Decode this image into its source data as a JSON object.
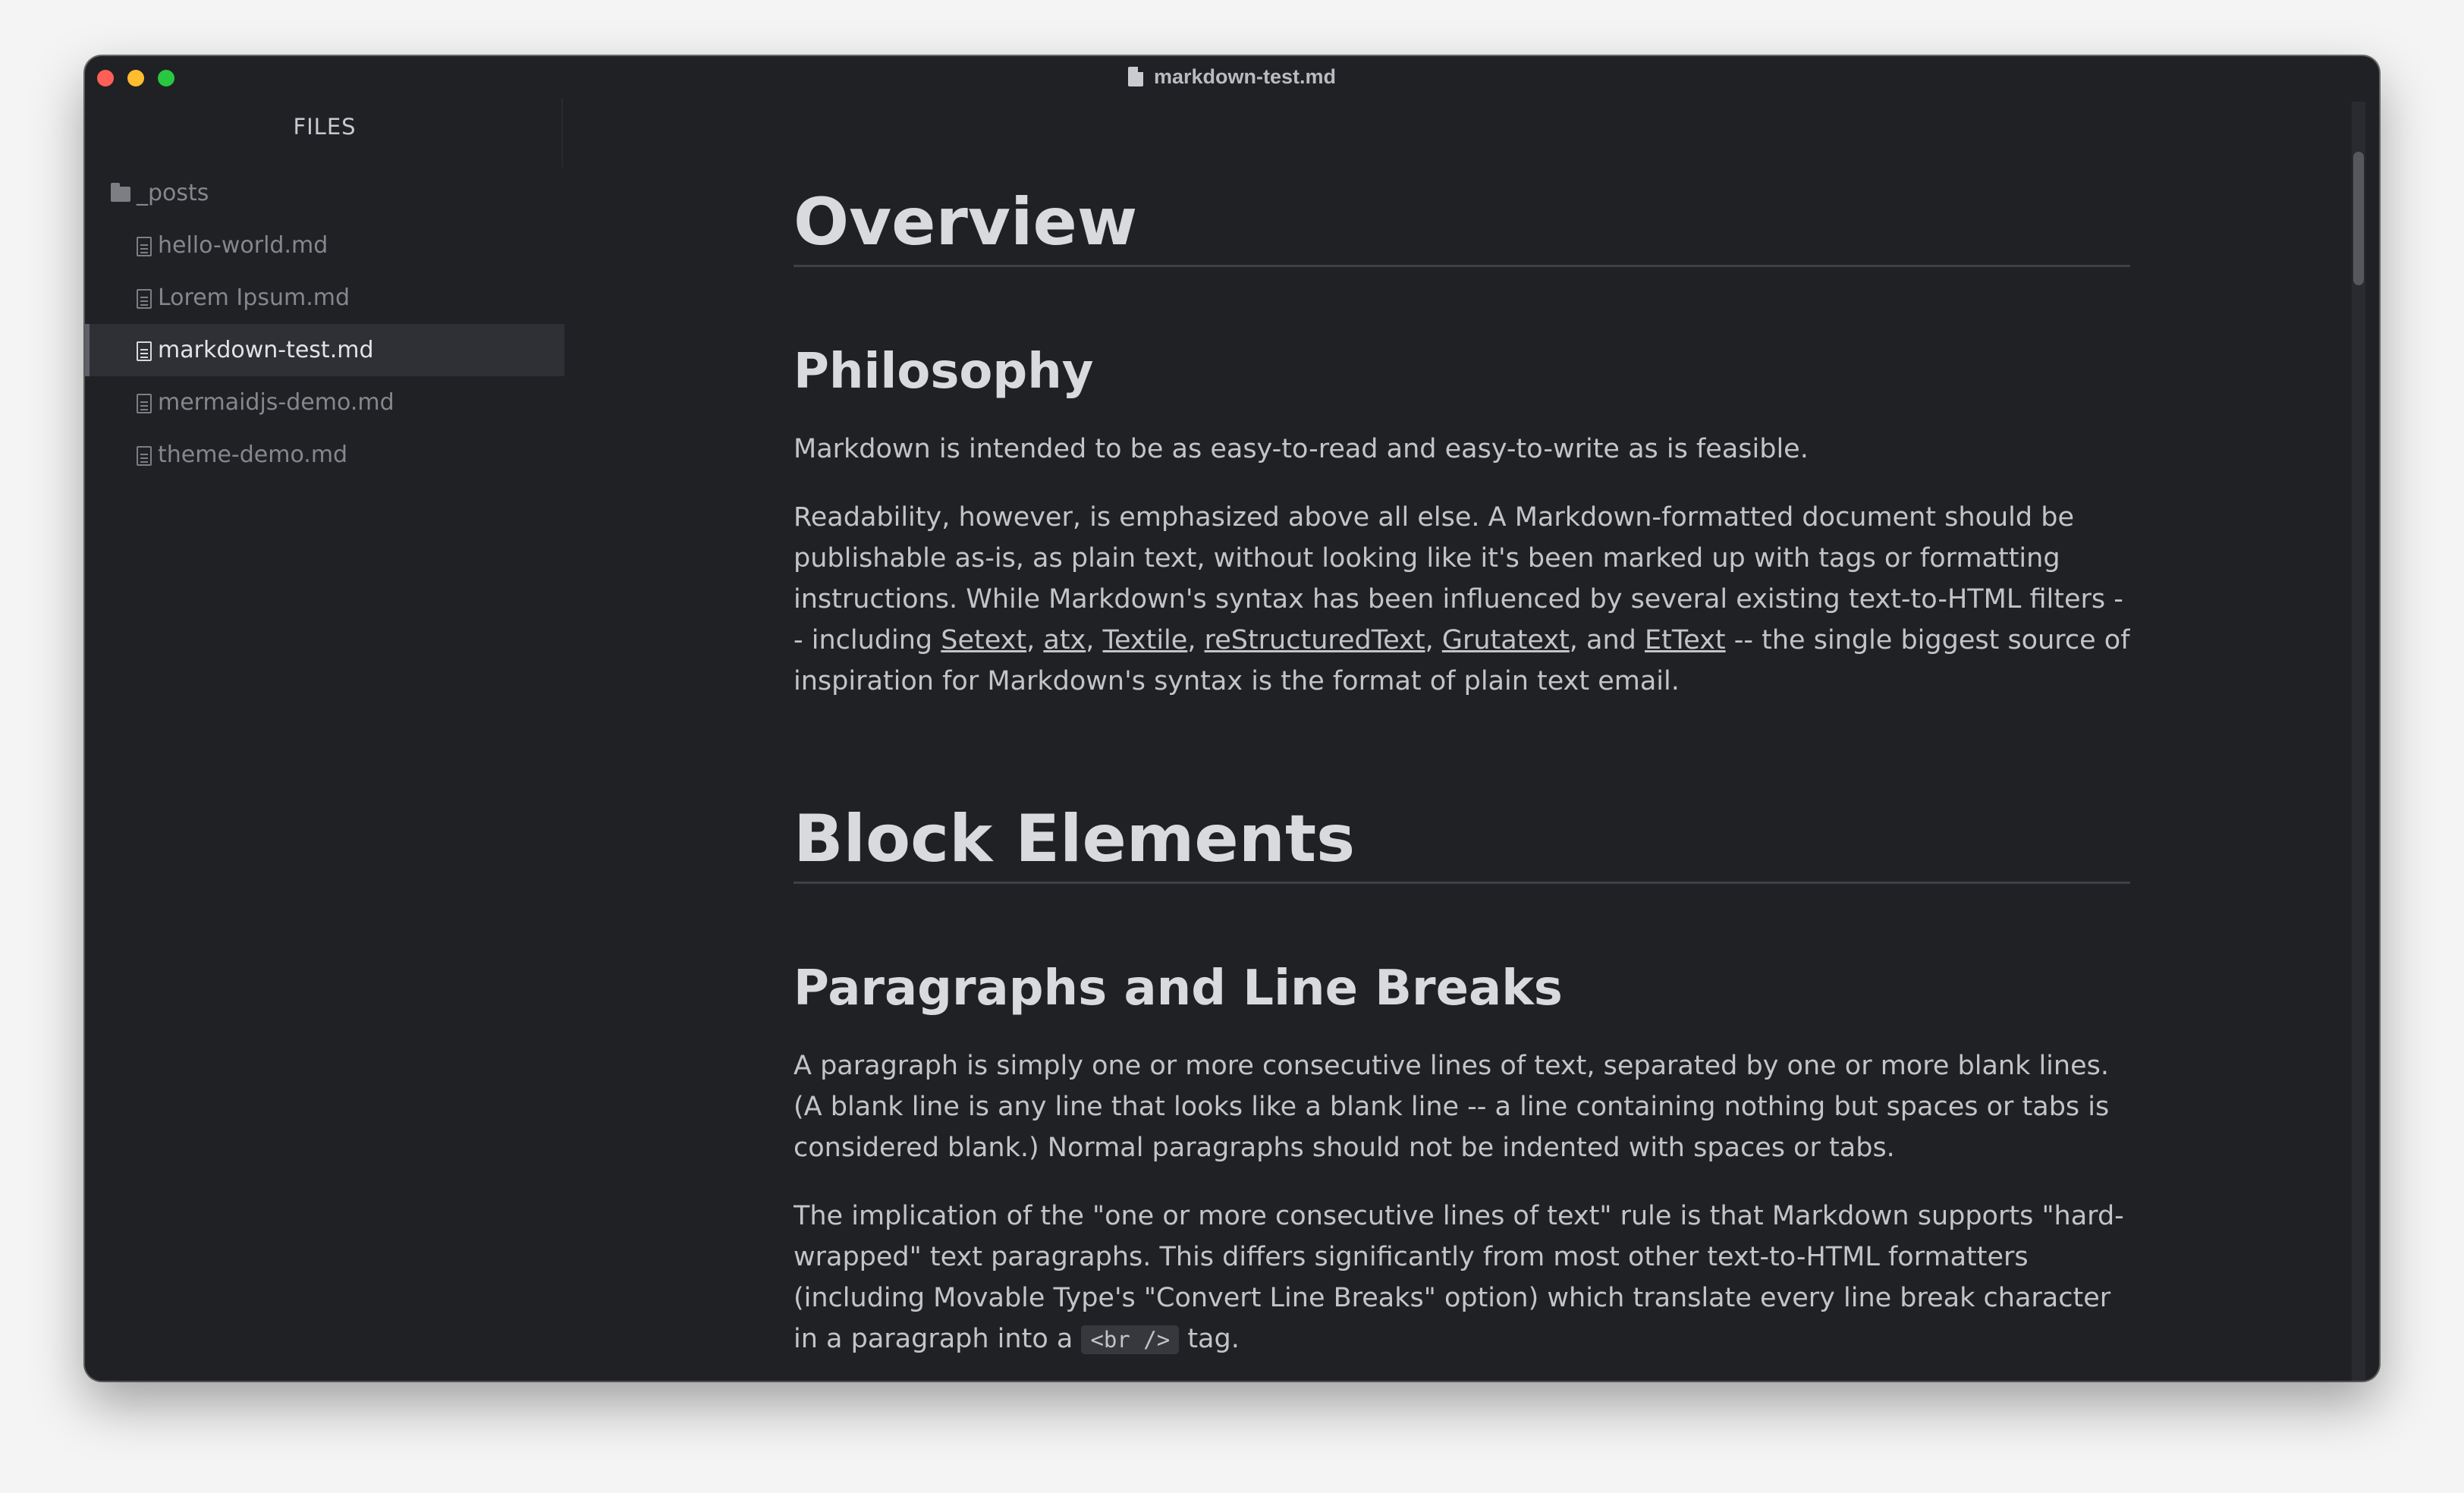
{
  "window": {
    "title": "markdown-test.md"
  },
  "sidebar": {
    "header": "FILES",
    "folder": "_posts",
    "files": [
      {
        "name": "hello-world.md",
        "active": false
      },
      {
        "name": "Lorem Ipsum.md",
        "active": false
      },
      {
        "name": "markdown-test.md",
        "active": true
      },
      {
        "name": "mermaidjs-demo.md",
        "active": false
      },
      {
        "name": "theme-demo.md",
        "active": false
      }
    ]
  },
  "document": {
    "h1_overview": "Overview",
    "h2_philosophy": "Philosophy",
    "p1": "Markdown is intended to be as easy-to-read and easy-to-write as is feasible.",
    "p2_part1": "Readability, however, is emphasized above all else. A Markdown-formatted document should be publishable as-is, as plain text, without looking like it's been marked up with tags or formatting instructions. While Markdown's syntax has been influenced by several existing text-to-HTML filters -- including ",
    "links": [
      "Setext",
      "atx",
      "Textile",
      "reStructuredText",
      "Grutatext",
      "EtText"
    ],
    "sep_comma": ", ",
    "sep_and": ", and ",
    "p2_part2": " -- the single biggest source of inspiration for Markdown's syntax is the format of plain text email.",
    "h1_block": "Block Elements",
    "h2_paragraphs": "Paragraphs and Line Breaks",
    "p3": "A paragraph is simply one or more consecutive lines of text, separated by one or more blank lines. (A blank line is any line that looks like a blank line -- a line containing nothing but spaces or tabs is considered blank.) Normal paragraphs should not be indented with spaces or tabs.",
    "p4_part1": "The implication of the \"one or more consecutive lines of text\" rule is that Markdown supports \"hard-wrapped\" text paragraphs. This differs significantly from most other text-to-HTML formatters (including Movable Type's \"Convert Line Breaks\" option) which translate every line break character in a paragraph into a ",
    "p4_code": "<br />",
    "p4_part2": " tag."
  }
}
